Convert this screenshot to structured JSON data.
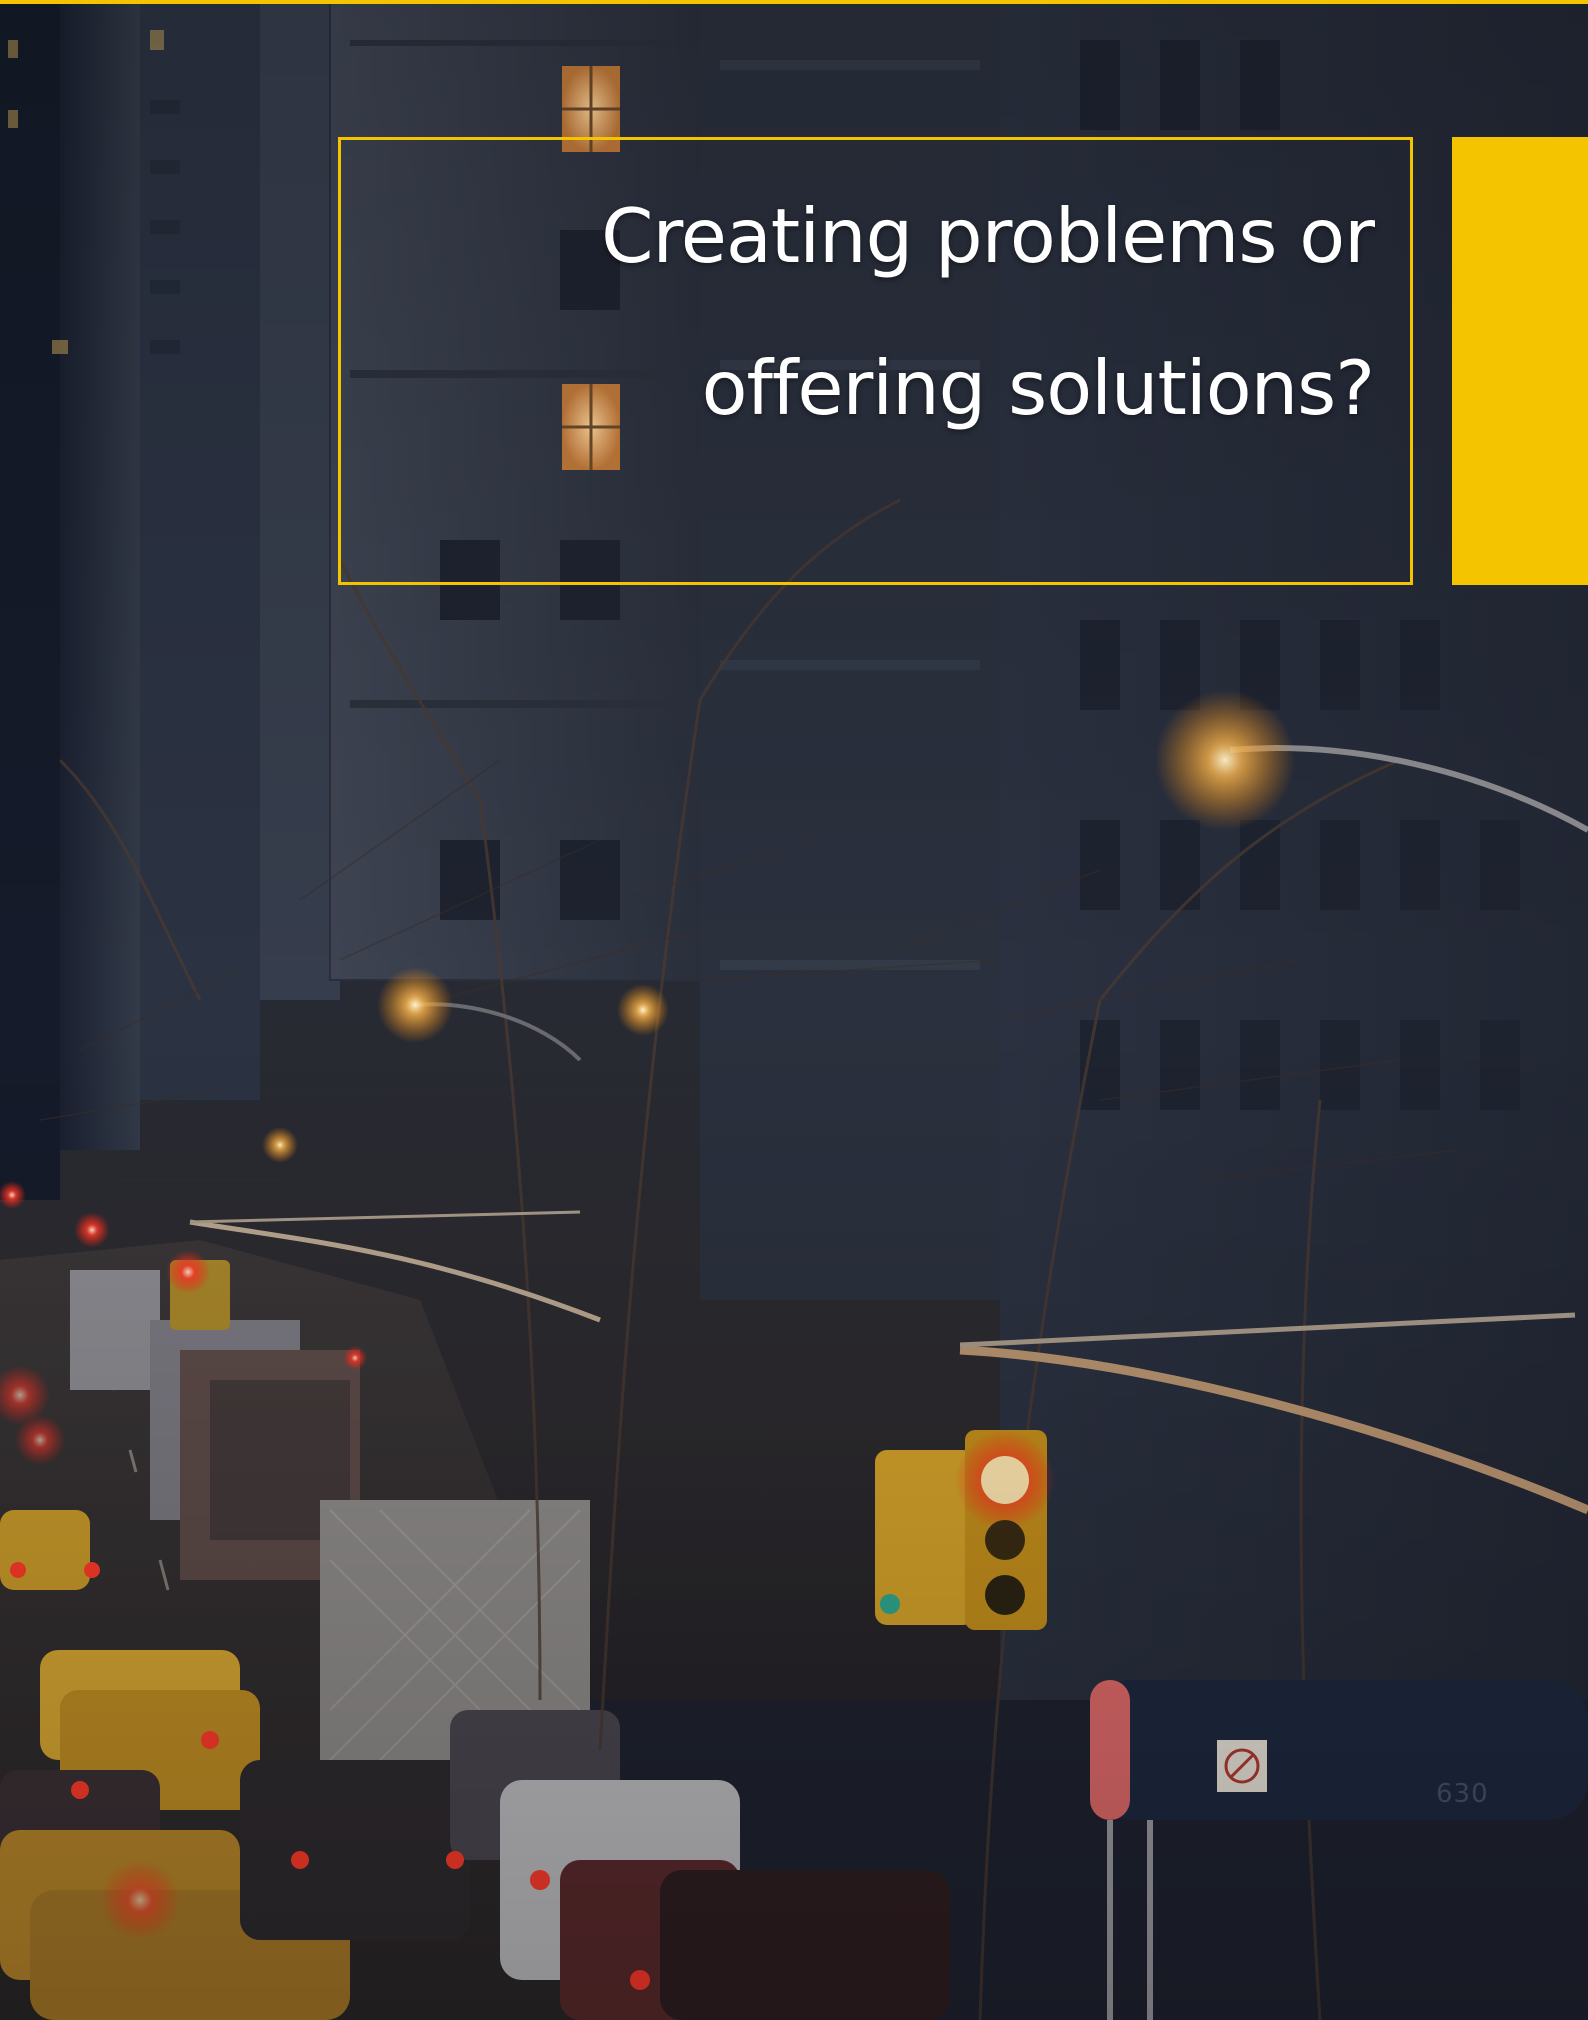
{
  "headline": {
    "line1": "Creating problems or",
    "line2": "offering solutions?"
  },
  "scene": {
    "awning_number": "630"
  },
  "colors": {
    "accent": "#f5c400",
    "sky": "#1b2130",
    "headline_text": "#ffffff"
  }
}
